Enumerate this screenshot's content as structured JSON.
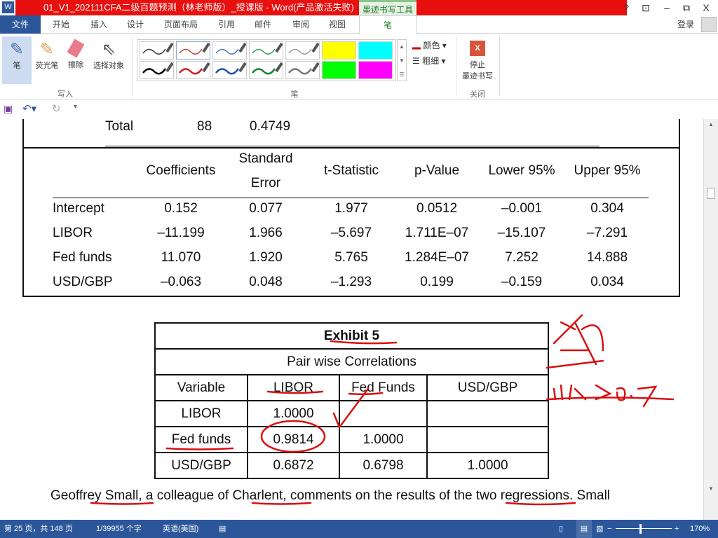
{
  "window": {
    "title": "01_V1_202111CFA二级百题预测（林老师版）_授课版 - Word(产品激活失败)",
    "tool_tab": "墨迹书写工具",
    "help": "?",
    "restore_ribbon": "⊡",
    "minimize": "–",
    "maximize": "⧉",
    "close": "X",
    "login": "登录"
  },
  "tabs": {
    "file": "文件",
    "items": [
      "开始",
      "插入",
      "设计",
      "页面布局",
      "引用",
      "邮件",
      "审阅",
      "视图"
    ],
    "active": "笔"
  },
  "ribbon": {
    "write_group": {
      "label": "写入",
      "buttons": [
        "笔",
        "荧光笔",
        "擦除",
        "选择对象"
      ]
    },
    "pens_group": {
      "label": "笔",
      "color": "颜色",
      "thickness": "粗细"
    },
    "close_group": {
      "label": "关闭",
      "stop": "停止",
      "stop2": "墨迹书写"
    },
    "pen_colors": [
      "#333333",
      "#c83c3c",
      "#4a78c8",
      "#3a9a5a",
      "#999999",
      "#ffff00",
      "#00ffff",
      "#000000",
      "#d02020",
      "#2050b0",
      "#108030",
      "#777777",
      "#00ff00",
      "#ff00ff"
    ]
  },
  "doc": {
    "top_row": {
      "label": "Total",
      "df": "88",
      "ss": "0.4749"
    },
    "reg": {
      "headers": [
        "Coefficients",
        "Standard",
        "Error",
        "t-Statistic",
        "p-Value",
        "Lower 95%",
        "Upper 95%"
      ],
      "rows": [
        [
          "Intercept",
          "0.152",
          "0.077",
          "1.977",
          "0.0512",
          "–0.001",
          "0.304"
        ],
        [
          "LIBOR",
          "–11.199",
          "1.966",
          "–5.697",
          "1.711E–07",
          "–15.107",
          "–7.291"
        ],
        [
          "Fed funds",
          "11.070",
          "1.920",
          "5.765",
          "1.284E–07",
          "7.252",
          "14.888"
        ],
        [
          "USD/GBP",
          "–0.063",
          "0.048",
          "–1.293",
          "0.199",
          "–0.159",
          "0.034"
        ]
      ]
    },
    "exhibit": {
      "title": "Exhibit 5",
      "subtitle": "Pair wise Correlations",
      "headers": [
        "Variable",
        "LIBOR",
        "Fed Funds",
        "USD/GBP"
      ],
      "rows": [
        [
          "LIBOR",
          "1.0000",
          "",
          ""
        ],
        [
          "Fed funds",
          "0.9814",
          "1.0000",
          ""
        ],
        [
          "USD/GBP",
          "0.6872",
          "0.6798",
          "1.0000"
        ]
      ]
    },
    "paragraph": "Geoffrey Small, a colleague of Charlent, comments on the results of the two regressions. Small"
  },
  "status": {
    "page": "第 25 页，共 148 页",
    "words": "1/39955 个字",
    "lang": "英语(美国)",
    "zoom": "170%"
  }
}
